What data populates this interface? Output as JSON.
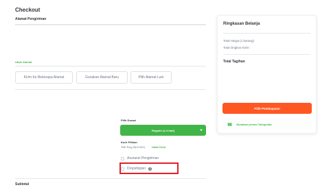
{
  "page_title": "Checkout",
  "shipping": {
    "address_title": "Alamat Pengiriman",
    "change_address": "Ubah Alamat",
    "buttons": [
      "Kirim Ke Beberapa Alamat",
      "Gunakan Alamat Baru",
      "Pilih Alamat Lain"
    ]
  },
  "delivery": {
    "duration_label": "Pilih Durasi",
    "duration_value": "Reguler (2-4 hari)",
    "courier_label": "Kurir Pilihan",
    "courier_value": "JNE Reg (Rp9.000)",
    "change_courier": "Ubah Kurir",
    "insurance": "Asuransi Pengiriman",
    "dropshipper": "Dropshipper"
  },
  "subtotal_label": "Subtotal",
  "summary": {
    "title": "Ringkasan Belanja",
    "total_price": "Total Harga (1 barang)",
    "total_shipping": "Total Ongkos Kirim",
    "total_bill": "Total Tagihan",
    "pay_button": "Pilih Pembayaran",
    "promo_text": "Gunakan promo Tokopedia"
  },
  "colors": {
    "accent_green": "#42b549",
    "pay_orange": "#ff5722",
    "highlight_red": "#e0202a"
  }
}
